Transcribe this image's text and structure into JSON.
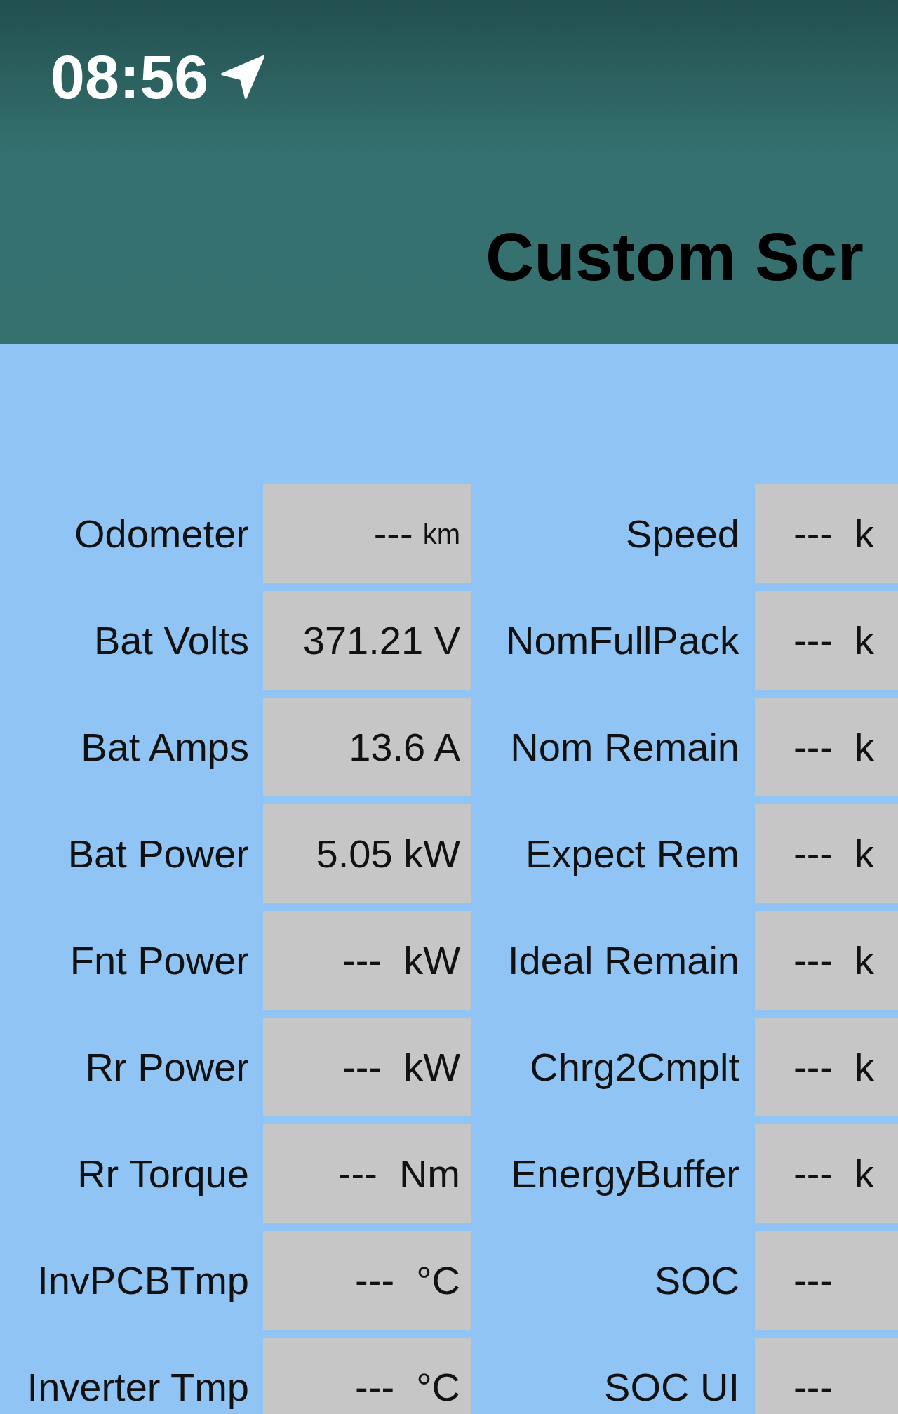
{
  "status_bar": {
    "time": "08:56"
  },
  "title": "Custom Scr",
  "rows": [
    {
      "cells": [
        {
          "label": "Odometer",
          "value": "---",
          "unit": "km"
        },
        {
          "label": "Speed",
          "value": "---  k"
        }
      ]
    },
    {
      "cells": [
        {
          "label": "Bat Volts",
          "value": "371.21 V"
        },
        {
          "label": "NomFullPack",
          "value": "---  k"
        }
      ]
    },
    {
      "cells": [
        {
          "label": "Bat Amps",
          "value": "13.6 A"
        },
        {
          "label": "Nom Remain",
          "value": "---  k"
        }
      ]
    },
    {
      "cells": [
        {
          "label": "Bat Power",
          "value": "5.05 kW"
        },
        {
          "label": "Expect Rem",
          "value": "---  k"
        }
      ]
    },
    {
      "cells": [
        {
          "label": "Fnt Power",
          "value": "---  kW"
        },
        {
          "label": "Ideal Remain",
          "value": "---  k"
        }
      ]
    },
    {
      "cells": [
        {
          "label": "Rr Power",
          "value": "---  kW"
        },
        {
          "label": "Chrg2Cmplt",
          "value": "---  k"
        }
      ]
    },
    {
      "cells": [
        {
          "label": "Rr Torque",
          "value": "---  Nm"
        },
        {
          "label": "EnergyBuffer",
          "value": "---  k"
        }
      ]
    },
    {
      "cells": [
        {
          "label": "InvPCBTmp",
          "value": "---  °C"
        },
        {
          "label": "SOC",
          "value": "---"
        }
      ]
    },
    {
      "cells": [
        {
          "label": "Inverter Tmp",
          "value": "---  °C"
        },
        {
          "label": "SOC UI",
          "value": "---"
        }
      ]
    }
  ]
}
